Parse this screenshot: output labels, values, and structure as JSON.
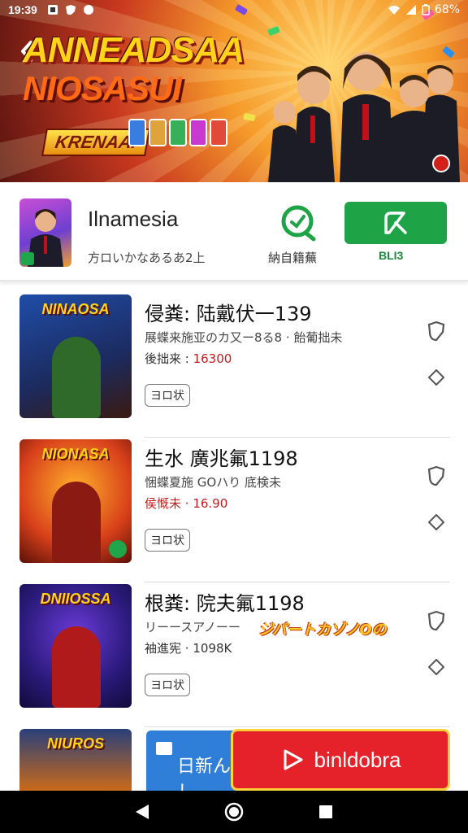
{
  "status_bar": {
    "time": "19:39",
    "battery": "68%"
  },
  "hero": {
    "title_line1": "ANNEADSAA",
    "title_line2": "NIOSASUI",
    "subtitle": "KRENAAI",
    "colors": {
      "accent": "#ffd31a",
      "deep": "#c9381f"
    }
  },
  "app": {
    "name": "Ilnamesia",
    "developer": "方ロいかなあるあ2上",
    "share_label": "納自籍蕪",
    "install_label": "BLI3",
    "install_color": "#1ea446"
  },
  "list": [
    {
      "thumb_title": "NINAOSA",
      "title": "侵粪: 陆戴伏一139",
      "line2": "展蝶来施亚のカ又ー8る8 · 飴葡拙未",
      "line3_prefix": "後拙来 : ",
      "line3_value": "16300",
      "tag": "ヨロ状"
    },
    {
      "thumb_title": "NIONASA",
      "title": "生水 廣兆氟1198",
      "line2": "悃蝶夏施 GOハり 底検未",
      "line3_prefix": "侯慨未 · ",
      "line3_value": "16.90",
      "tag": "ヨロ状"
    },
    {
      "thumb_title": "DNIIOSSA",
      "title": "根粪: 院夫氟1198",
      "line2": "リーースアノーー",
      "promo": "ジパートカゾノOの",
      "line3_prefix": "袖進宪 · ",
      "line3_value": "1098K",
      "tag": "ヨロ状"
    }
  ],
  "partial_item": {
    "thumb_title": "NIUROS"
  },
  "blue_card": {
    "text": "日新んし"
  },
  "cta": {
    "label": "binldobra",
    "color": "#e5222a"
  }
}
